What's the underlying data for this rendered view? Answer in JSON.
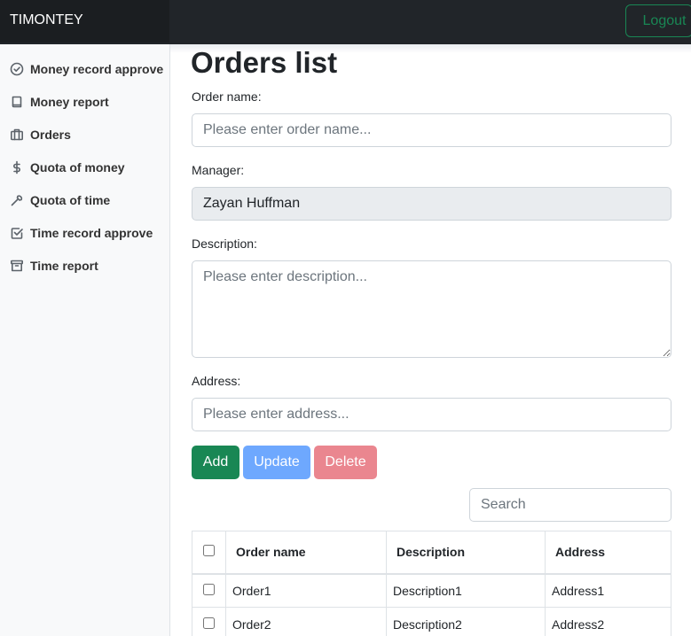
{
  "header": {
    "brand": "TIMONTEY",
    "logout_label": "Logout"
  },
  "sidebar": {
    "items": [
      {
        "label": "Money record approve",
        "icon": "check-circle-icon"
      },
      {
        "label": "Money report",
        "icon": "book-icon"
      },
      {
        "label": "Orders",
        "icon": "briefcase-icon"
      },
      {
        "label": "Quota of money",
        "icon": "dollar-icon"
      },
      {
        "label": "Quota of time",
        "icon": "wrench-icon"
      },
      {
        "label": "Time record approve",
        "icon": "check-square-icon"
      },
      {
        "label": "Time report",
        "icon": "archive-icon"
      }
    ]
  },
  "main": {
    "title": "Orders list",
    "order_name": {
      "label": "Order name:",
      "placeholder": "Please enter order name...",
      "value": ""
    },
    "manager": {
      "label": "Manager:",
      "value": "Zayan Huffman"
    },
    "description": {
      "label": "Description:",
      "placeholder": "Please enter description...",
      "value": ""
    },
    "address": {
      "label": "Address:",
      "placeholder": "Please enter address...",
      "value": ""
    },
    "buttons": {
      "add": "Add",
      "update": "Update",
      "delete": "Delete"
    },
    "search_placeholder": "Search"
  },
  "table": {
    "columns": [
      "Order name",
      "Description",
      "Address"
    ],
    "rows": [
      {
        "order_name": "Order1",
        "description": "Description1",
        "address": "Address1"
      },
      {
        "order_name": "Order2",
        "description": "Description2",
        "address": "Address2"
      }
    ]
  },
  "colors": {
    "topbar": "#212529",
    "success": "#198754",
    "primary_disabled": "#6ea8fe",
    "danger_disabled": "#ea868f",
    "sidebar_bg": "#f8f9fa"
  }
}
